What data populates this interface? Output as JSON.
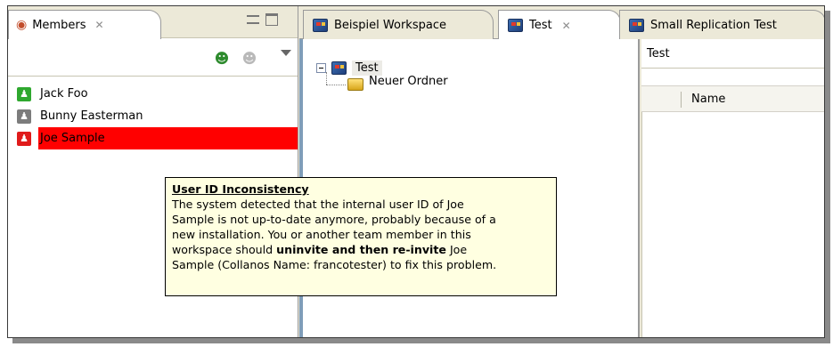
{
  "members_view": {
    "tab_label": "Members",
    "members": [
      {
        "name": "Jack Foo",
        "status_color": "#2fa82f",
        "selected": false
      },
      {
        "name": "Bunny Easterman",
        "status_color": "#7c7c7c",
        "selected": false
      },
      {
        "name": "Joe Sample",
        "status_color": "#e01b1b",
        "selected": true
      }
    ],
    "toolbar_icons": [
      "add-member-icon",
      "remove-member-icon",
      "view-menu-icon"
    ]
  },
  "editor_tabs": [
    {
      "label": "Beispiel Workspace",
      "active": false
    },
    {
      "label": "Test",
      "active": true
    },
    {
      "label": "Small Replication Test",
      "active": false
    }
  ],
  "tree": {
    "root": "Test",
    "children": [
      "Neuer Ordner"
    ]
  },
  "details_panel": {
    "title": "Test",
    "columns": [
      "Name"
    ]
  },
  "tooltip": {
    "title": "User ID Inconsistency",
    "line1": "The system detected that the internal user ID of Joe",
    "line2": "Sample is not up-to-date anymore, probably because of a",
    "line3": "new installation. You or another team member in this",
    "line4_pre": "workspace should ",
    "line4_bold": "uninvite and then re-invite",
    "line4_post": " Joe",
    "line5": "Sample (Collanos Name: francotester) to fix this problem."
  }
}
